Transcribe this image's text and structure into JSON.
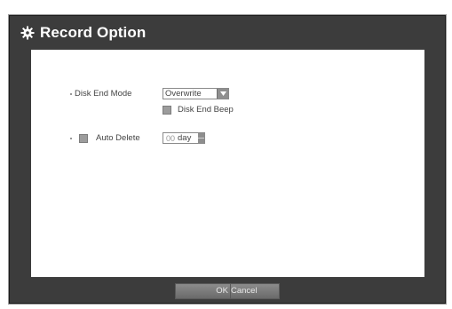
{
  "dialog": {
    "title": "Record Option",
    "title_icon": "gear-icon"
  },
  "disk_end_mode": {
    "label": "Disk End Mode",
    "value": "Overwrite"
  },
  "disk_end_beep": {
    "label": "Disk End Beep",
    "checked": true
  },
  "auto_delete": {
    "label": "Auto Delete",
    "checked": true,
    "value": "00",
    "unit": "day"
  },
  "footer": {
    "ok_label": "OK",
    "cancel_label": "Cancel"
  },
  "colors": {
    "frame": "#3c3c3c",
    "content": "#ffffff",
    "checkbox": "#9c9c9c",
    "button": "#7a7a7a"
  }
}
